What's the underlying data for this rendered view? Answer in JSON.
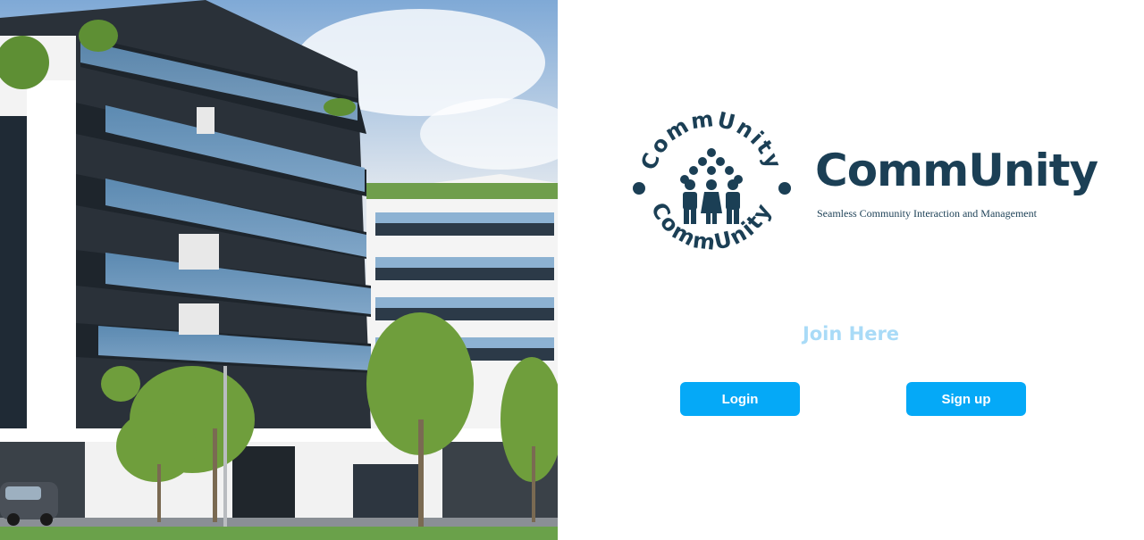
{
  "hero": {
    "icon": "apartment-building-photo"
  },
  "logo": {
    "ring_text_top": "CommUnity",
    "ring_text_bottom": "CommUnity",
    "icon": "community-people-icon"
  },
  "brand": {
    "title": "CommUnity",
    "tagline": "Seamless Community Interaction and Management"
  },
  "join": {
    "heading": "Join Here"
  },
  "buttons": {
    "login": "Login",
    "signup": "Sign up"
  },
  "colors": {
    "brand_dark": "#1b3f55",
    "button": "#05a9f7",
    "join_text": "#a9dbf7"
  }
}
